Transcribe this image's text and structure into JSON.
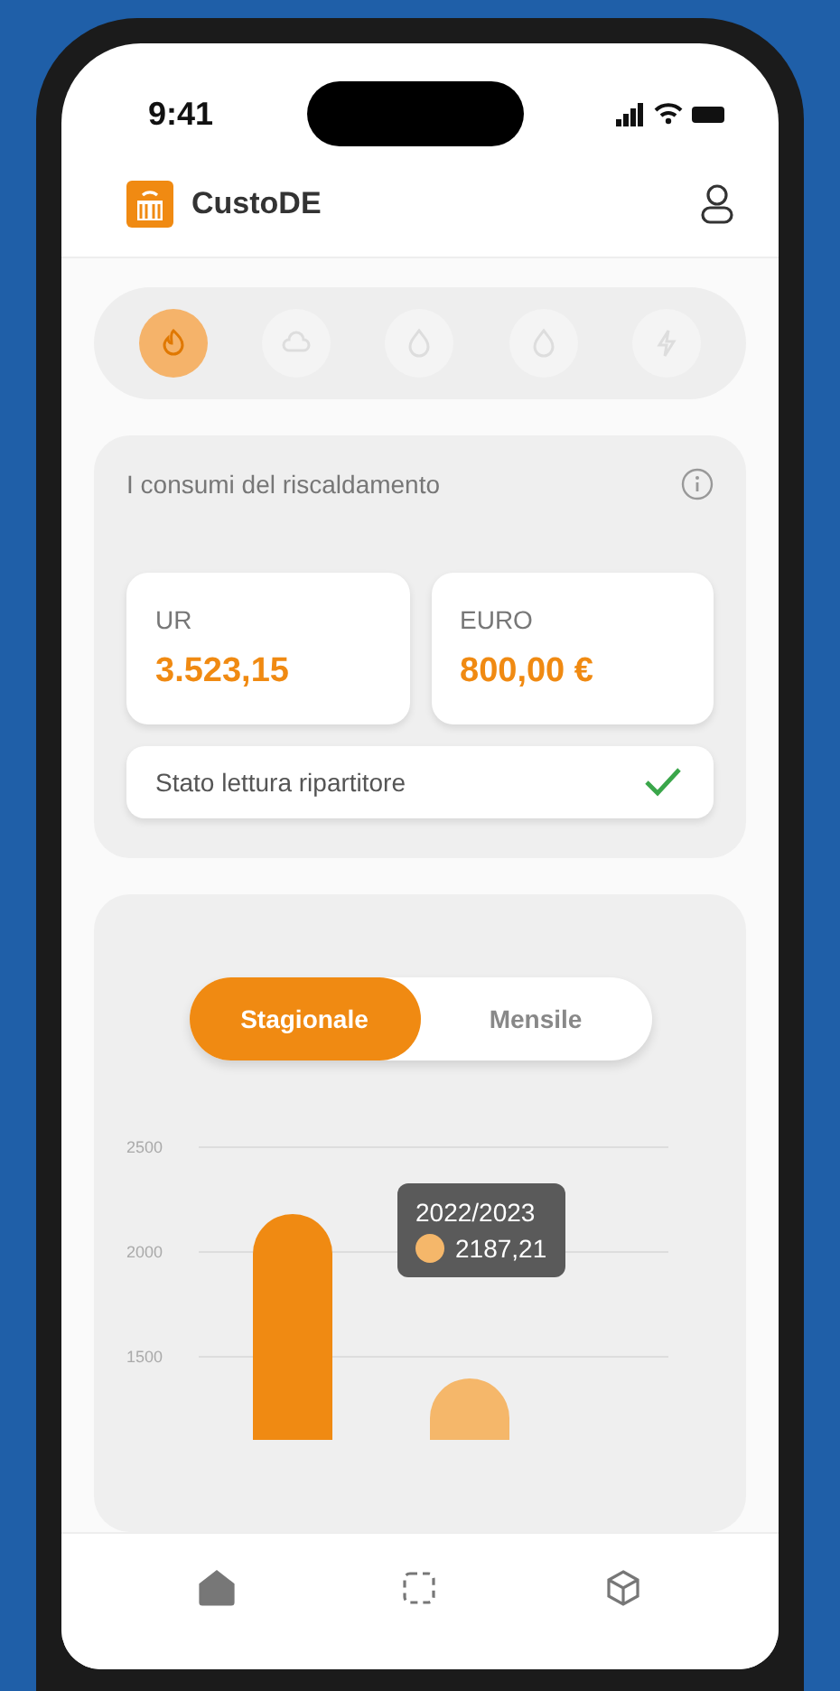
{
  "status_bar": {
    "time": "9:41"
  },
  "header": {
    "app_name": "CustoDE"
  },
  "categories": [
    {
      "kind": "heating",
      "selected": true
    },
    {
      "kind": "gas",
      "selected": false
    },
    {
      "kind": "water",
      "selected": false
    },
    {
      "kind": "hot-water",
      "selected": false
    },
    {
      "kind": "electricity",
      "selected": false
    }
  ],
  "consumption_card": {
    "title": "I consumi del riscaldamento",
    "metrics": [
      {
        "label": "UR",
        "value": "3.523,15"
      },
      {
        "label": "EURO",
        "value": "800,00 €"
      }
    ],
    "status": {
      "label": "Stato lettura ripartitore",
      "checked": true
    }
  },
  "period_tabs": [
    {
      "label": "Stagionale",
      "selected": true
    },
    {
      "label": "Mensile",
      "selected": false
    }
  ],
  "chart": {
    "y_axis_labels": [
      "2500",
      "2000",
      "1500"
    ],
    "tooltip": {
      "title": "2022/2023",
      "value": "2187,21"
    }
  },
  "bottom_nav": [
    {
      "kind": "home",
      "selected": true
    },
    {
      "kind": "scan",
      "selected": false
    },
    {
      "kind": "box",
      "selected": false
    }
  ]
}
